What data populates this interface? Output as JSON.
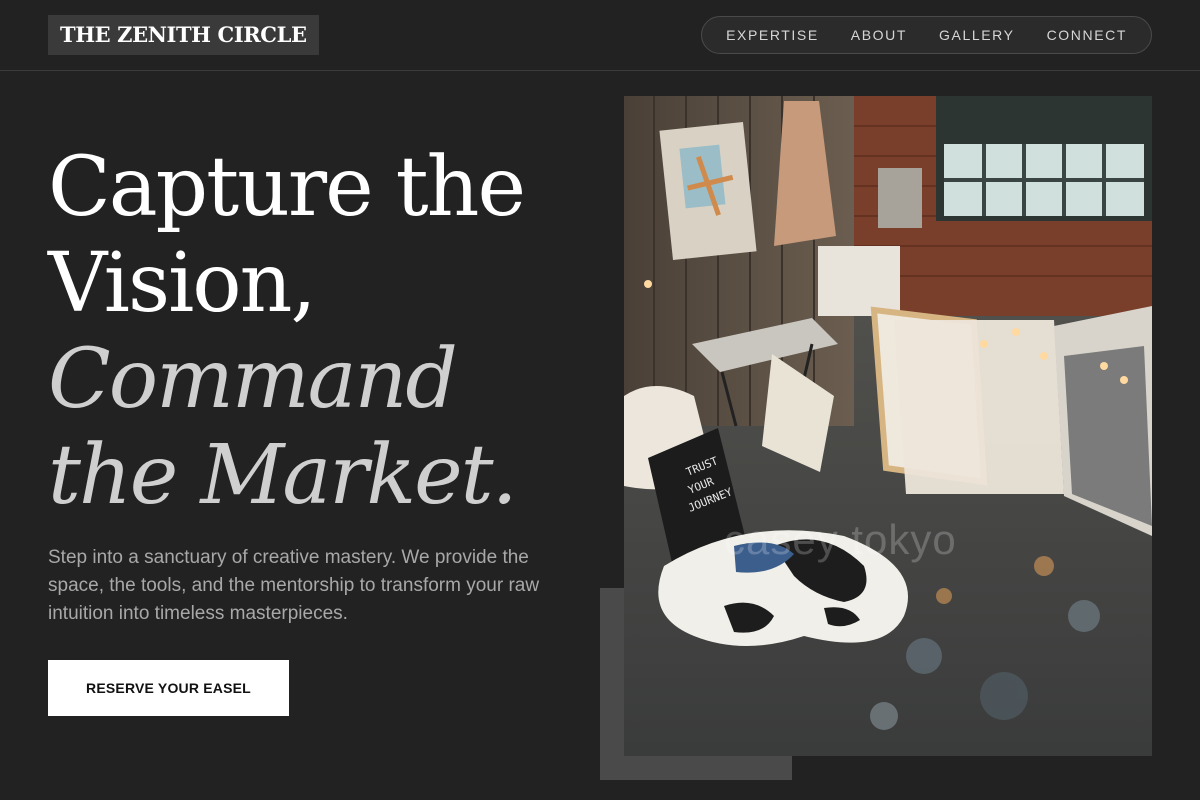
{
  "header": {
    "logo": "THE ZENITH CIRCLE",
    "nav": [
      "EXPERTISE",
      "ABOUT",
      "GALLERY",
      "CONNECT"
    ]
  },
  "hero": {
    "headline": {
      "line1": "Capture the",
      "line2": "Vision,",
      "line3": "Command",
      "line4": "the Market."
    },
    "lede": "Step into a sanctuary of creative mastery. We provide the space, the tools, and the mentorship to transform your raw intuition into timeless masterpieces.",
    "cta_label": "RESERVE YOUR EASEL"
  },
  "image": {
    "sign_text": "TRUST YOUR JOURNEY",
    "watermark": "casey tokyo"
  },
  "colors": {
    "background": "#222222",
    "accent_text": "#cfcfcf",
    "button": "#ffffff",
    "frame": "#4a4a4a"
  }
}
